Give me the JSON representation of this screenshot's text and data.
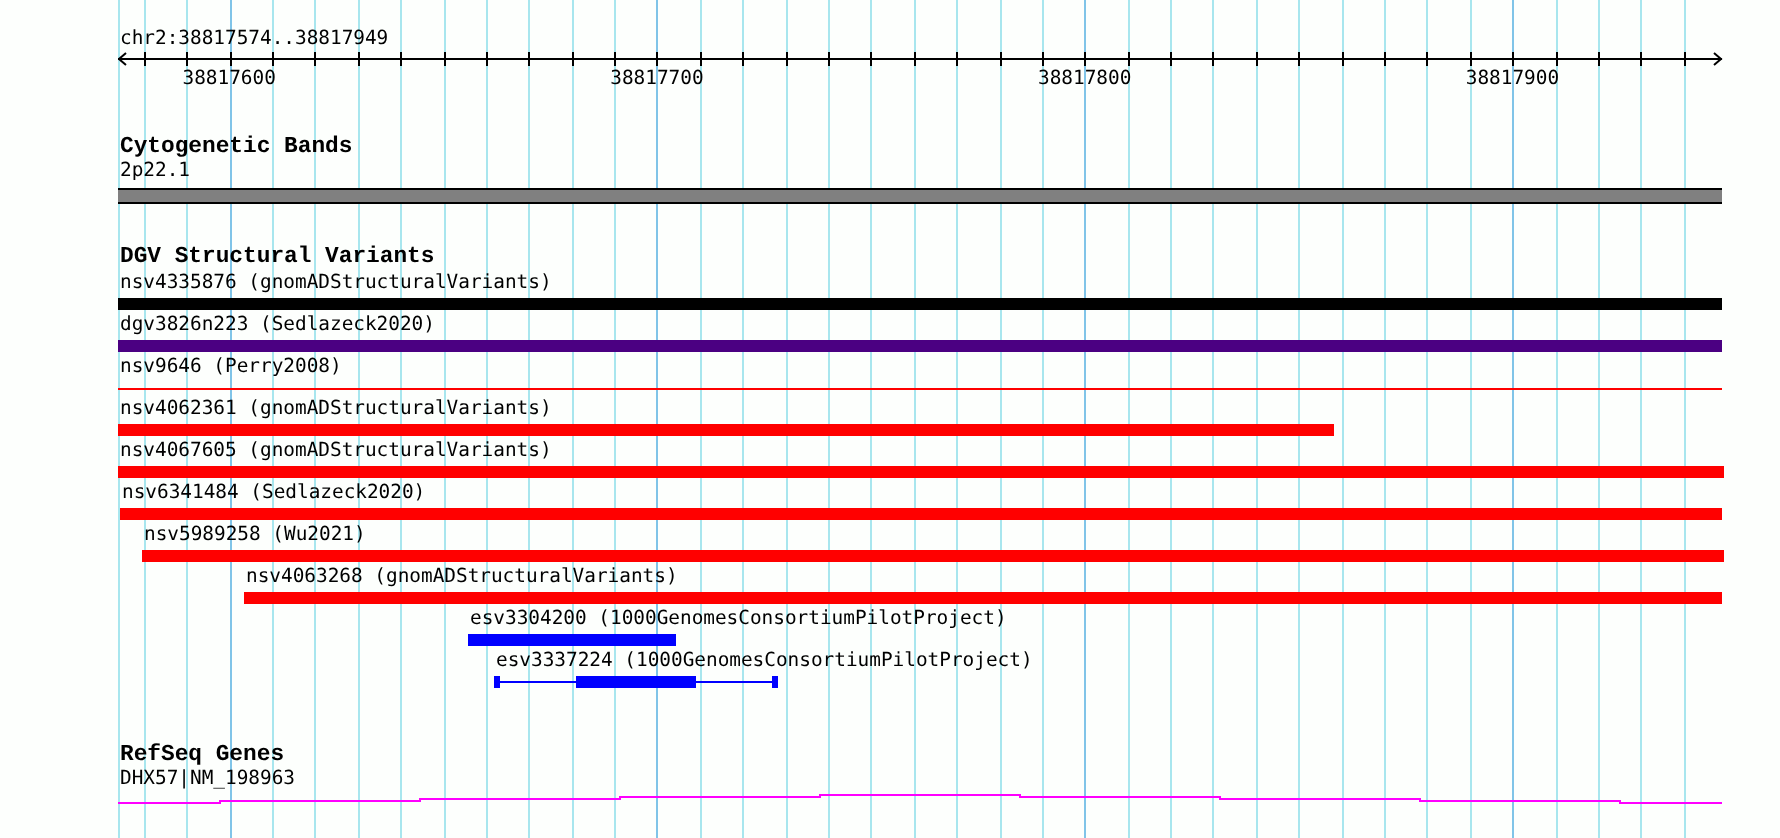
{
  "ruler": {
    "title": "chr2:38817574..38817949",
    "tick_labels": [
      "38817600",
      "38817700",
      "38817800",
      "38817900"
    ]
  },
  "tracks": [
    {
      "kind": "bands",
      "title": "Cytogenetic Bands",
      "features": [
        {
          "label": "2p22.1"
        }
      ]
    },
    {
      "kind": "variants",
      "title": "DGV Structural Variants",
      "features": [
        {
          "label": "nsv4335876 (gnomADStructuralVariants)",
          "color": "#000000",
          "kind": "bar"
        },
        {
          "label": "dgv3826n223 (Sedlazeck2020)",
          "color": "#4b0082",
          "kind": "bar"
        },
        {
          "label": "nsv9646 (Perry2008)",
          "color": "#ff0000",
          "kind": "line"
        },
        {
          "label": "nsv4062361 (gnomADStructuralVariants)",
          "color": "#ff0000",
          "kind": "bar"
        },
        {
          "label": "nsv4067605 (gnomADStructuralVariants)",
          "color": "#ff0000",
          "kind": "bar"
        },
        {
          "label": "nsv6341484 (Sedlazeck2020)",
          "color": "#ff0000",
          "kind": "bar"
        },
        {
          "label": "nsv5989258 (Wu2021)",
          "color": "#ff0000",
          "kind": "bar"
        },
        {
          "label": "nsv4063268 (gnomADStructuralVariants)",
          "color": "#ff0000",
          "kind": "bar"
        },
        {
          "label": "esv3304200 (1000GenomesConsortiumPilotProject)",
          "color": "#0000ff",
          "kind": "bar"
        },
        {
          "label": "esv3337224 (1000GenomesConsortiumPilotProject)",
          "color": "#0000ff",
          "kind": "gapped"
        }
      ]
    },
    {
      "kind": "genes",
      "title": "RefSeq Genes",
      "features": [
        {
          "label": "DHX57|NM_198963"
        }
      ]
    }
  ]
}
